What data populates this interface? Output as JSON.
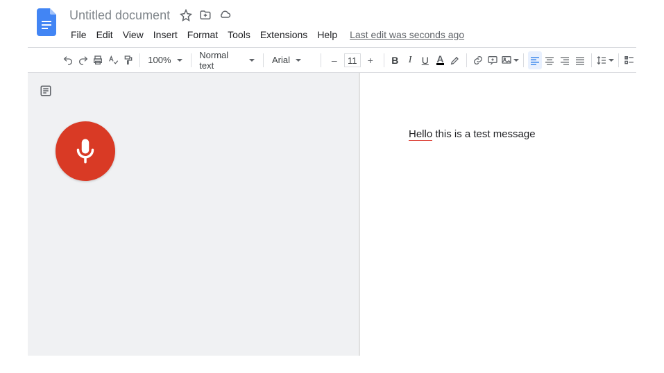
{
  "header": {
    "title": "Untitled document",
    "last_edit": "Last edit was seconds ago"
  },
  "menu": {
    "file": "File",
    "edit": "Edit",
    "view": "View",
    "insert": "Insert",
    "format": "Format",
    "tools": "Tools",
    "extensions": "Extensions",
    "help": "Help"
  },
  "toolbar": {
    "zoom": "100%",
    "style": "Normal text",
    "font": "Arial",
    "font_size": "11",
    "bold": "B",
    "italic": "I",
    "underline": "U",
    "text_color_letter": "A",
    "minus": "–",
    "plus": "+"
  },
  "document": {
    "spell_word": "Hello",
    "rest_text": " this is a test message"
  }
}
